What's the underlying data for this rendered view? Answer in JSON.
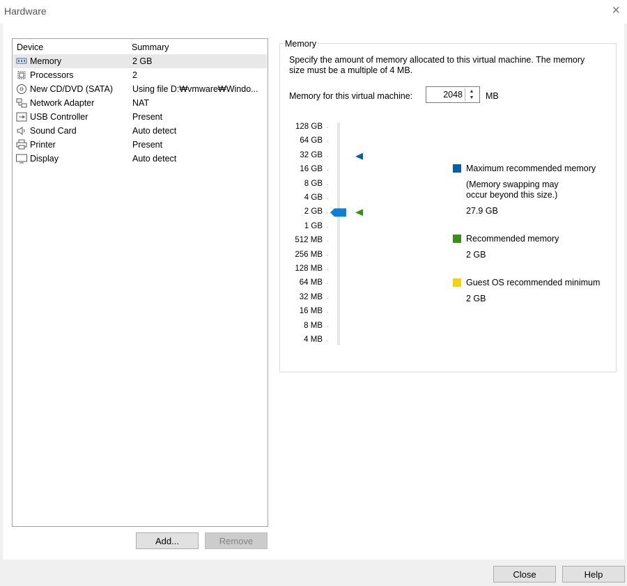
{
  "window": {
    "title": "Hardware",
    "close_glyph": "×"
  },
  "device_list": {
    "headers": {
      "device": "Device",
      "summary": "Summary"
    },
    "rows": [
      {
        "icon": "memory-icon",
        "name": "Memory",
        "summary": "2 GB",
        "selected": true
      },
      {
        "icon": "processor-icon",
        "name": "Processors",
        "summary": "2"
      },
      {
        "icon": "cd-dvd-icon",
        "name": "New CD/DVD (SATA)",
        "summary": "Using file D:₩vmware₩Windo..."
      },
      {
        "icon": "network-adapter-icon",
        "name": "Network Adapter",
        "summary": "NAT"
      },
      {
        "icon": "usb-controller-icon",
        "name": "USB Controller",
        "summary": "Present"
      },
      {
        "icon": "sound-card-icon",
        "name": "Sound Card",
        "summary": "Auto detect"
      },
      {
        "icon": "printer-icon",
        "name": "Printer",
        "summary": "Present"
      },
      {
        "icon": "display-icon",
        "name": "Display",
        "summary": "Auto detect"
      }
    ],
    "add_label": "Add...",
    "remove_label": "Remove"
  },
  "memory": {
    "group_title": "Memory",
    "description_line1": "Specify the amount of memory allocated to this virtual machine. The memory",
    "description_line2": "size must be a multiple of 4 MB.",
    "field_label": "Memory for this virtual machine:",
    "value": "2048",
    "unit": "MB",
    "scale": [
      "128 GB",
      "64 GB",
      "32 GB",
      "16 GB",
      "8 GB",
      "4 GB",
      "2 GB",
      "1 GB",
      "512 MB",
      "256 MB",
      "128 MB",
      "64 MB",
      "32 MB",
      "16 MB",
      "8 MB",
      "4 MB"
    ],
    "slider_level": "2 GB",
    "max_marker_level": "32 GB",
    "recommended_marker_level": "2 GB",
    "legend": {
      "max_label": "Maximum recommended memory",
      "max_note_line1": "(Memory swapping may",
      "max_note_line2": "occur beyond this size.)",
      "max_value": "27.9 GB",
      "recommended_label": "Recommended memory",
      "recommended_value": "2 GB",
      "guest_min_label": "Guest OS recommended minimum",
      "guest_min_value": "2 GB"
    },
    "colors": {
      "maximum": "#0a5ea8",
      "recommended": "#3c8e1c",
      "guest_minimum": "#f5d211",
      "slider": "#0f7fd6"
    }
  },
  "footer": {
    "close_label": "Close",
    "help_label": "Help"
  }
}
